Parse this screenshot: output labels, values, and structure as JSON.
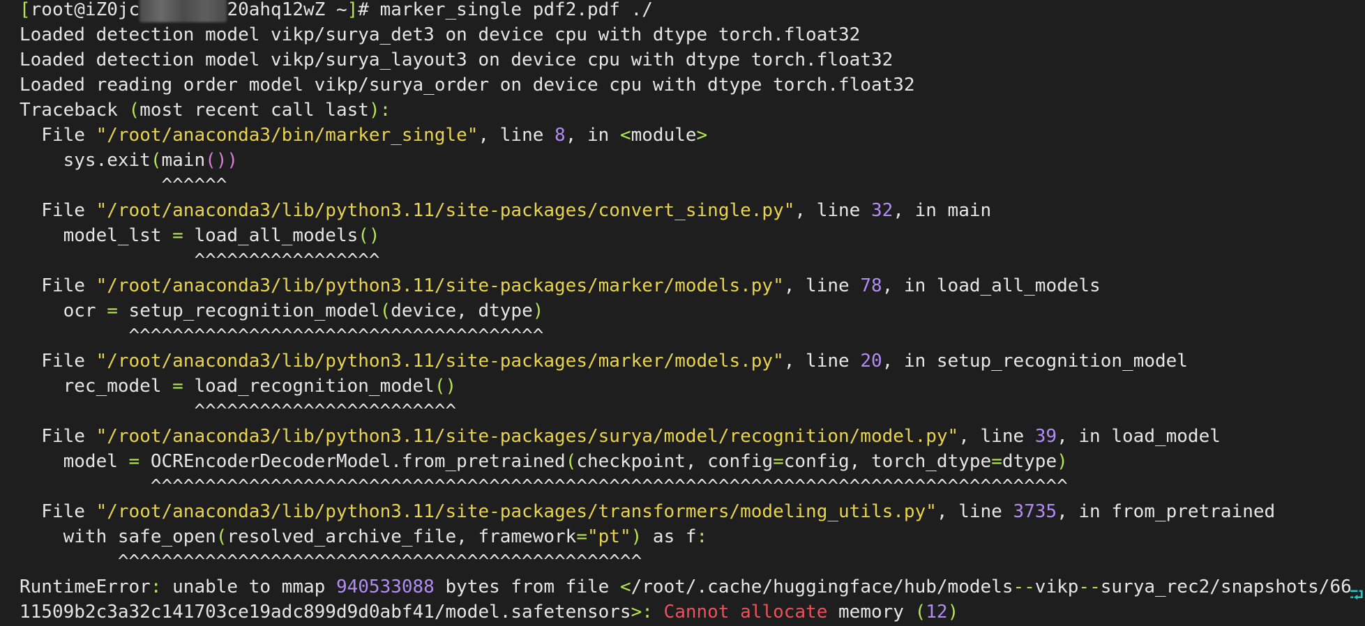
{
  "terminal": {
    "lines": [
      [
        {
          "t": "[",
          "c": "grn"
        },
        {
          "t": "root@iZ0jc",
          "c": "txt"
        },
        {
          "t": "xxxxxxxx",
          "c": "blur"
        },
        {
          "t": "20ahq12wZ ~",
          "c": "txt"
        },
        {
          "t": "]",
          "c": "grn"
        },
        {
          "t": "# marker_single pdf2.pdf ./",
          "c": "txt"
        }
      ],
      [
        {
          "t": "Loaded detection model vikp/surya_det3 on device cpu with dtype torch.float32",
          "c": "txt"
        }
      ],
      [
        {
          "t": "Loaded detection model vikp/surya_layout3 on device cpu with dtype torch.float32",
          "c": "txt"
        }
      ],
      [
        {
          "t": "Loaded reading order model vikp/surya_order on device cpu with dtype torch.float32",
          "c": "txt"
        }
      ],
      [
        {
          "t": "Traceback ",
          "c": "txt"
        },
        {
          "t": "(",
          "c": "grn"
        },
        {
          "t": "most recent call last",
          "c": "txt"
        },
        {
          "t": "):",
          "c": "grn"
        }
      ],
      [
        {
          "t": "  File ",
          "c": "txt"
        },
        {
          "t": "\"/root/anaconda3/bin/marker_single\"",
          "c": "yel"
        },
        {
          "t": ", line ",
          "c": "txt"
        },
        {
          "t": "8",
          "c": "pur"
        },
        {
          "t": ", in ",
          "c": "txt"
        },
        {
          "t": "<",
          "c": "grn"
        },
        {
          "t": "module",
          "c": "txt"
        },
        {
          "t": ">",
          "c": "grn"
        }
      ],
      [
        {
          "t": "    sys.exit",
          "c": "txt"
        },
        {
          "t": "(",
          "c": "grn"
        },
        {
          "t": "main",
          "c": "txt"
        },
        {
          "t": "())",
          "c": "pnk"
        }
      ],
      [
        {
          "t": "             ^^^^^^",
          "c": "txt"
        }
      ],
      [
        {
          "t": "  File ",
          "c": "txt"
        },
        {
          "t": "\"/root/anaconda3/lib/python3.11/site-packages/convert_single.py\"",
          "c": "yel"
        },
        {
          "t": ", line ",
          "c": "txt"
        },
        {
          "t": "32",
          "c": "pur"
        },
        {
          "t": ", in main",
          "c": "txt"
        }
      ],
      [
        {
          "t": "    model_lst ",
          "c": "txt"
        },
        {
          "t": "=",
          "c": "grn"
        },
        {
          "t": " load_all_models",
          "c": "txt"
        },
        {
          "t": "()",
          "c": "grn"
        }
      ],
      [
        {
          "t": "                ^^^^^^^^^^^^^^^^^",
          "c": "txt"
        }
      ],
      [
        {
          "t": "  File ",
          "c": "txt"
        },
        {
          "t": "\"/root/anaconda3/lib/python3.11/site-packages/marker/models.py\"",
          "c": "yel"
        },
        {
          "t": ", line ",
          "c": "txt"
        },
        {
          "t": "78",
          "c": "pur"
        },
        {
          "t": ", in load_all_models",
          "c": "txt"
        }
      ],
      [
        {
          "t": "    ocr ",
          "c": "txt"
        },
        {
          "t": "=",
          "c": "grn"
        },
        {
          "t": " setup_recognition_model",
          "c": "txt"
        },
        {
          "t": "(",
          "c": "grn"
        },
        {
          "t": "device, dtype",
          "c": "txt"
        },
        {
          "t": ")",
          "c": "grn"
        }
      ],
      [
        {
          "t": "          ^^^^^^^^^^^^^^^^^^^^^^^^^^^^^^^^^^^^^^",
          "c": "txt"
        }
      ],
      [
        {
          "t": "  File ",
          "c": "txt"
        },
        {
          "t": "\"/root/anaconda3/lib/python3.11/site-packages/marker/models.py\"",
          "c": "yel"
        },
        {
          "t": ", line ",
          "c": "txt"
        },
        {
          "t": "20",
          "c": "pur"
        },
        {
          "t": ", in setup_recognition_model",
          "c": "txt"
        }
      ],
      [
        {
          "t": "    rec_model ",
          "c": "txt"
        },
        {
          "t": "=",
          "c": "grn"
        },
        {
          "t": " load_recognition_model",
          "c": "txt"
        },
        {
          "t": "()",
          "c": "grn"
        }
      ],
      [
        {
          "t": "                ^^^^^^^^^^^^^^^^^^^^^^^^",
          "c": "txt"
        }
      ],
      [
        {
          "t": "  File ",
          "c": "txt"
        },
        {
          "t": "\"/root/anaconda3/lib/python3.11/site-packages/surya/model/recognition/model.py\"",
          "c": "yel"
        },
        {
          "t": ", line ",
          "c": "txt"
        },
        {
          "t": "39",
          "c": "pur"
        },
        {
          "t": ", in load_model",
          "c": "txt"
        }
      ],
      [
        {
          "t": "    model ",
          "c": "txt"
        },
        {
          "t": "=",
          "c": "grn"
        },
        {
          "t": " OCREncoderDecoderModel.from_pretrained",
          "c": "txt"
        },
        {
          "t": "(",
          "c": "grn"
        },
        {
          "t": "checkpoint, config",
          "c": "txt"
        },
        {
          "t": "=",
          "c": "grn"
        },
        {
          "t": "config, torch_dtype",
          "c": "txt"
        },
        {
          "t": "=",
          "c": "grn"
        },
        {
          "t": "dtype",
          "c": "txt"
        },
        {
          "t": ")",
          "c": "grn"
        }
      ],
      [
        {
          "t": "            ^^^^^^^^^^^^^^^^^^^^^^^^^^^^^^^^^^^^^^^^^^^^^^^^^^^^^^^^^^^^^^^^^^^^^^^^^^^^^^^^^^^^",
          "c": "txt"
        }
      ],
      [
        {
          "t": "  File ",
          "c": "txt"
        },
        {
          "t": "\"/root/anaconda3/lib/python3.11/site-packages/transformers/modeling_utils.py\"",
          "c": "yel"
        },
        {
          "t": ", line ",
          "c": "txt"
        },
        {
          "t": "3735",
          "c": "pur"
        },
        {
          "t": ", in from_pretrained",
          "c": "txt"
        }
      ],
      [
        {
          "t": "    with safe_open",
          "c": "txt"
        },
        {
          "t": "(",
          "c": "grn"
        },
        {
          "t": "resolved_archive_file, framework",
          "c": "txt"
        },
        {
          "t": "=",
          "c": "grn"
        },
        {
          "t": "\"pt\"",
          "c": "yel"
        },
        {
          "t": ")",
          "c": "grn"
        },
        {
          "t": " as f",
          "c": "txt"
        },
        {
          "t": ":",
          "c": "grn"
        }
      ],
      [
        {
          "t": "         ^^^^^^^^^^^^^^^^^^^^^^^^^^^^^^^^^^^^^^^^^^^^^^^^",
          "c": "txt"
        }
      ],
      [
        {
          "t": "RuntimeError",
          "c": "txt"
        },
        {
          "t": ":",
          "c": "grn"
        },
        {
          "t": " unable to mmap ",
          "c": "txt"
        },
        {
          "t": "940533088",
          "c": "pur"
        },
        {
          "t": " bytes from file ",
          "c": "txt"
        },
        {
          "t": "<",
          "c": "grn"
        },
        {
          "t": "/root/.cache/huggingface/hub/models",
          "c": "txt"
        },
        {
          "t": "--",
          "c": "grn"
        },
        {
          "t": "vikp",
          "c": "txt"
        },
        {
          "t": "--",
          "c": "grn"
        },
        {
          "t": "surya_rec2/snapshots/66",
          "c": "txt"
        }
      ],
      [
        {
          "t": "11509b2c3a32c141703ce19adc899d9d0abf41/model.safetensors",
          "c": "txt"
        },
        {
          "t": ">:",
          "c": "grn"
        },
        {
          "t": " Cannot allocate",
          "c": "red"
        },
        {
          "t": " memory ",
          "c": "txt"
        },
        {
          "t": "(",
          "c": "grn"
        },
        {
          "t": "12",
          "c": "pur"
        },
        {
          "t": ")",
          "c": "grn"
        }
      ]
    ],
    "wrap_marker": "⮒"
  }
}
